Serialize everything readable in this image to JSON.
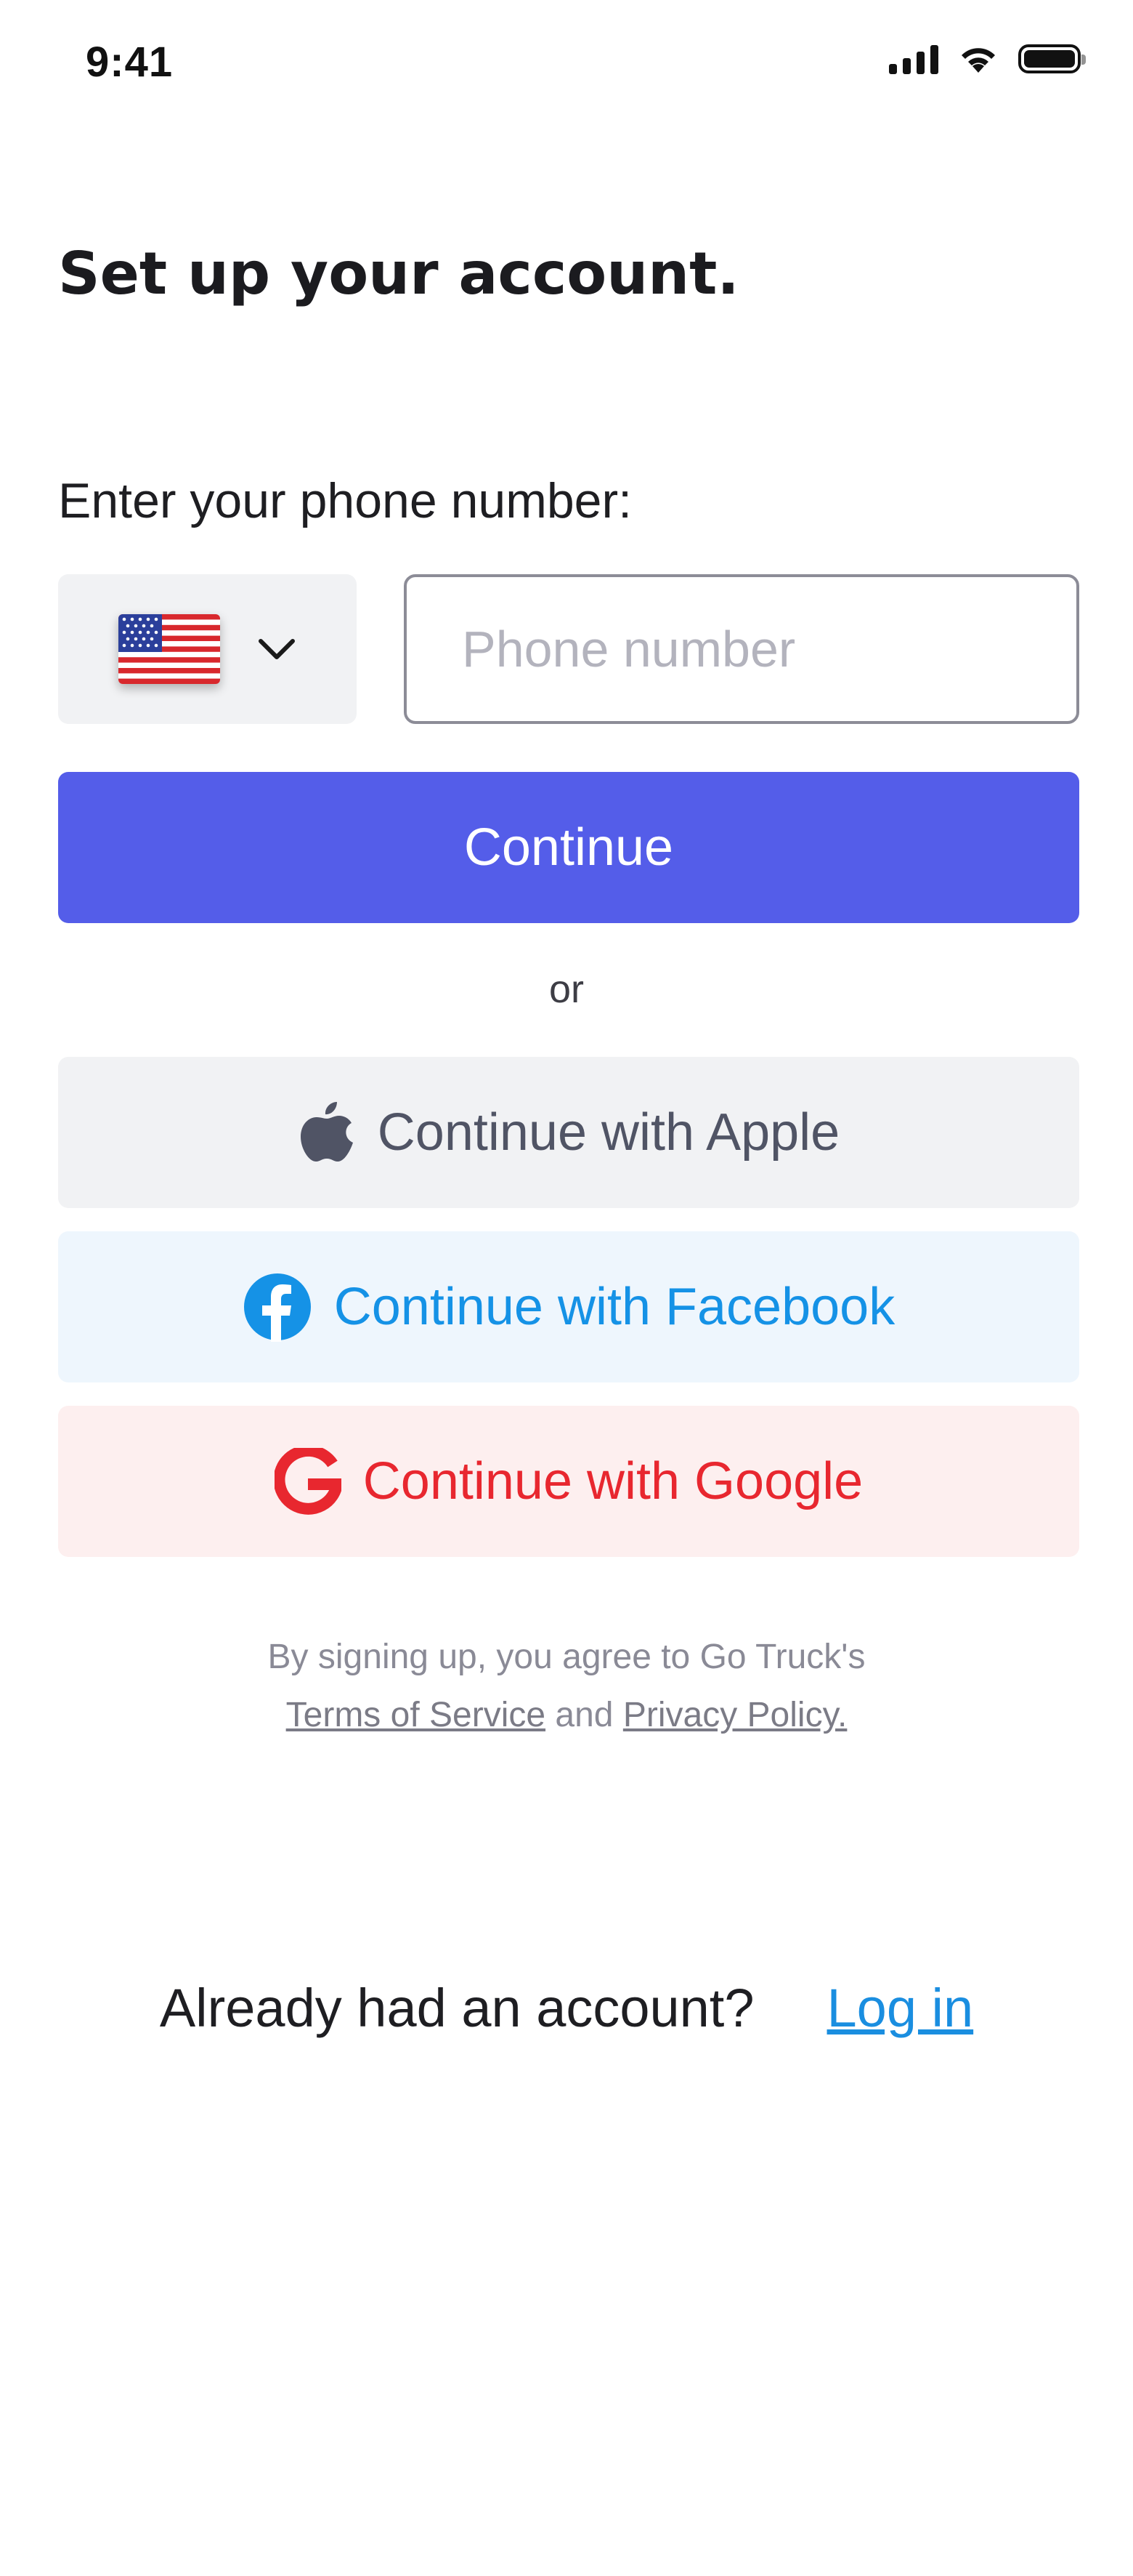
{
  "status_bar": {
    "time": "9:41"
  },
  "header": {
    "title": "Set up your account."
  },
  "phone": {
    "label": "Enter your phone number:",
    "country_flag": "us-flag-icon",
    "placeholder": "Phone number",
    "value": ""
  },
  "actions": {
    "continue_label": "Continue",
    "or_label": "or",
    "apple_label": "Continue with Apple",
    "facebook_label": "Continue with Facebook",
    "google_label": "Continue with Google"
  },
  "terms": {
    "prefix": "By signing up, you agree to Go Truck's",
    "tos_label": "Terms of Service",
    "and_label": "and",
    "privacy_label": "Privacy Policy."
  },
  "login": {
    "question": "Already had an account?",
    "link_label": "Log in"
  },
  "colors": {
    "primary": "#545de9",
    "facebook": "#1592e6",
    "google": "#e8272f",
    "link": "#1a8ee0"
  }
}
